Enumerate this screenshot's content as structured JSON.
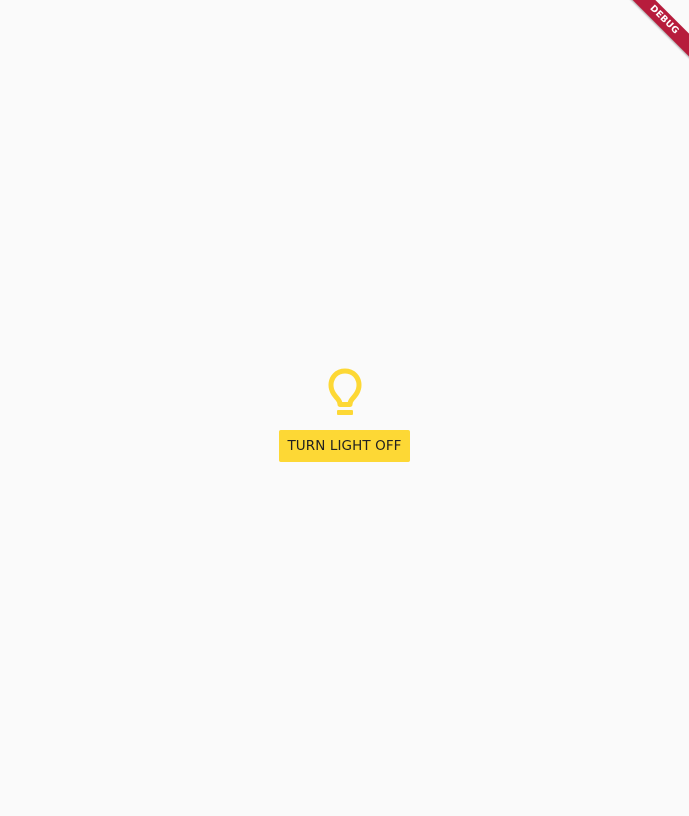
{
  "app": {
    "button_label": "TURN LIGHT OFF",
    "light_on": true,
    "bulb_icon": "lightbulb-outline-icon",
    "accent_color": "#fdd835",
    "background_color": "#fafafa"
  },
  "debug_banner": {
    "label": "DEBUG",
    "color": "#b71c3c"
  }
}
